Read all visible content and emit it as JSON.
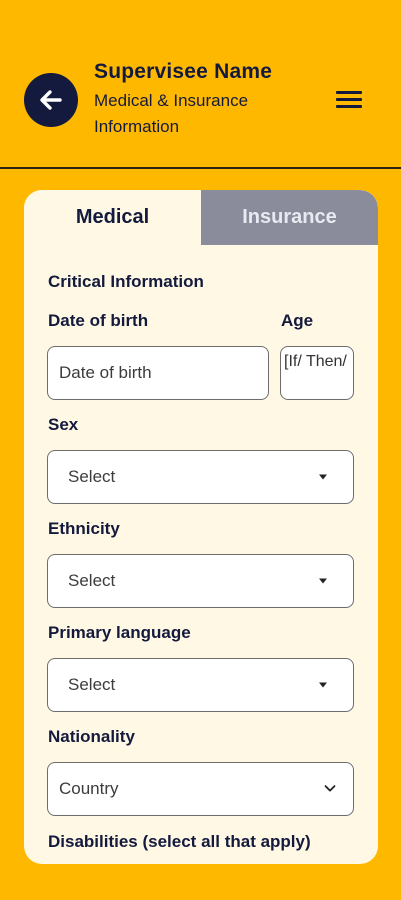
{
  "header": {
    "title": "Supervisee Name",
    "subtitle": "Medical & Insurance Information"
  },
  "tabs": [
    {
      "label": "Medical",
      "active": true
    },
    {
      "label": "Insurance",
      "active": false
    }
  ],
  "form": {
    "section_title": "Critical Information",
    "dob_label": "Date of birth",
    "dob_placeholder": "Date of birth",
    "age_label": "Age",
    "age_value": "[If/ Then/",
    "sex_label": "Sex",
    "sex_value": "Select",
    "ethnicity_label": "Ethnicity",
    "ethnicity_value": "Select",
    "language_label": "Primary language",
    "language_value": "Select",
    "nationality_label": "Nationality",
    "nationality_value": "Country",
    "disabilities_label": "Disabilities (select all that apply)"
  },
  "colors": {
    "background": "#FFB800",
    "navy": "#141a3d",
    "card": "#FFF8E4",
    "inactive_tab": "#8a8c9c"
  },
  "icons": {
    "back": "arrow-left-icon",
    "menu": "hamburger-menu-icon",
    "caret": "caret-down-icon",
    "chevron": "chevron-down-icon"
  }
}
